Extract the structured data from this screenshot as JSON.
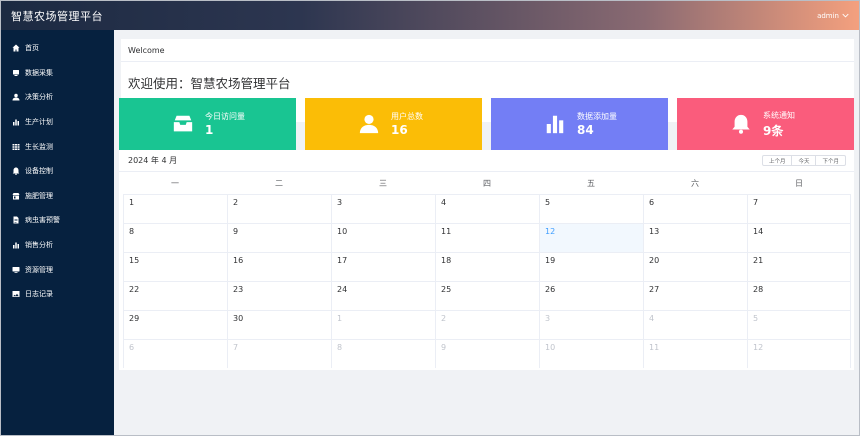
{
  "app": {
    "title": "智慧农场管理平台",
    "user": "admin",
    "user_chevron": "chevron-down-icon"
  },
  "sidebar": {
    "items": [
      {
        "label": "首页",
        "icon": "home-icon"
      },
      {
        "label": "数据采集",
        "icon": "database-icon"
      },
      {
        "label": "决策分析",
        "icon": "user-icon"
      },
      {
        "label": "生产计划",
        "icon": "bar-chart-icon"
      },
      {
        "label": "生长监测",
        "icon": "grid-icon"
      },
      {
        "label": "设备控制",
        "icon": "bell-icon"
      },
      {
        "label": "施肥管理",
        "icon": "shop-icon"
      },
      {
        "label": "病虫害预警",
        "icon": "document-icon"
      },
      {
        "label": "销售分析",
        "icon": "bar-chart-icon"
      },
      {
        "label": "资源管理",
        "icon": "monitor-icon"
      },
      {
        "label": "日志记录",
        "icon": "picture-icon"
      }
    ]
  },
  "welcome": {
    "header": "Welcome",
    "title": "欢迎使用：智慧农场管理平台"
  },
  "stats": [
    {
      "label": "今日访问量",
      "value": "1",
      "icon": "tray-icon",
      "color": "#19c592"
    },
    {
      "label": "用户总数",
      "value": "16",
      "icon": "user-icon",
      "color": "#fbbd06"
    },
    {
      "label": "数据添加量",
      "value": "84",
      "icon": "bar-chart-icon",
      "color": "#737ef5"
    },
    {
      "label": "系统通知",
      "value": "9条",
      "icon": "bell-icon",
      "color": "#fa5c7c"
    }
  ],
  "calendar": {
    "month_label": "2024 年 4 月",
    "buttons": {
      "prev": "上个月",
      "today": "今天",
      "next": "下个月"
    },
    "weekdays": [
      "一",
      "二",
      "三",
      "四",
      "五",
      "六",
      "日"
    ],
    "today": "12",
    "weeks": [
      [
        "1",
        "2",
        "3",
        "4",
        "5",
        "6",
        "7"
      ],
      [
        "8",
        "9",
        "10",
        "11",
        "12",
        "13",
        "14"
      ],
      [
        "15",
        "16",
        "17",
        "18",
        "19",
        "20",
        "21"
      ],
      [
        "22",
        "23",
        "24",
        "25",
        "26",
        "27",
        "28"
      ],
      [
        "29",
        "30",
        "1",
        "2",
        "3",
        "4",
        "5"
      ],
      [
        "6",
        "7",
        "8",
        "9",
        "10",
        "11",
        "12"
      ]
    ],
    "other_month": [
      [
        false,
        false,
        false,
        false,
        false,
        false,
        false
      ],
      [
        false,
        false,
        false,
        false,
        false,
        false,
        false
      ],
      [
        false,
        false,
        false,
        false,
        false,
        false,
        false
      ],
      [
        false,
        false,
        false,
        false,
        false,
        false,
        false
      ],
      [
        false,
        false,
        true,
        true,
        true,
        true,
        true
      ],
      [
        true,
        true,
        true,
        true,
        true,
        true,
        true
      ]
    ]
  },
  "colors": {
    "sidebar": "#06213f",
    "today": "#409eff",
    "other_month": "#c0c4cc"
  }
}
